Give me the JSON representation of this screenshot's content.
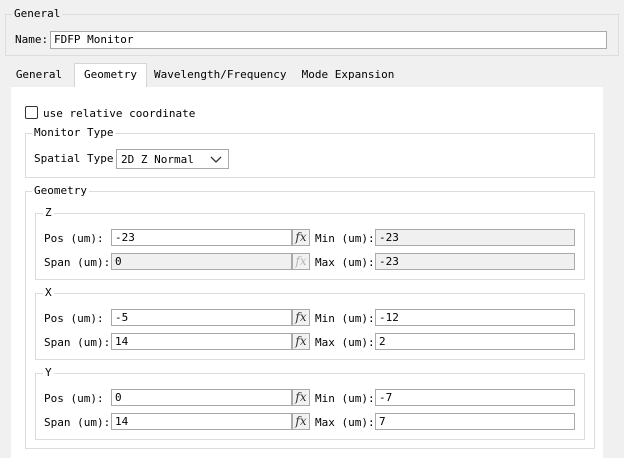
{
  "general_group": {
    "title": "General",
    "name_label": "Name:",
    "name_value": "FDFP Monitor"
  },
  "tabs": [
    {
      "label": "General"
    },
    {
      "label": "Geometry"
    },
    {
      "label": "Wavelength/Frequency"
    },
    {
      "label": "Mode Expansion"
    }
  ],
  "relative_coord": {
    "label": "use relative coordinate",
    "checked": false
  },
  "monitor_type": {
    "title": "Monitor Type",
    "spatial_label": "Spatial Type:",
    "spatial_value": "2D Z Normal"
  },
  "geometry": {
    "title": "Geometry",
    "fx_label": "fx",
    "z": {
      "title": "Z",
      "pos_label": "Pos (um):",
      "pos_value": "-23",
      "span_label": "Span (um):",
      "span_value": "0",
      "min_label": "Min (um):",
      "min_value": "-23",
      "max_label": "Max (um):",
      "max_value": "-23"
    },
    "x": {
      "title": "X",
      "pos_label": "Pos (um):",
      "pos_value": "-5",
      "span_label": "Span (um):",
      "span_value": "14",
      "min_label": "Min (um):",
      "min_value": "-12",
      "max_label": "Max (um):",
      "max_value": "2"
    },
    "y": {
      "title": "Y",
      "pos_label": "Pos (um):",
      "pos_value": "0",
      "span_label": "Span (um):",
      "span_value": "14",
      "min_label": "Min (um):",
      "min_value": "-7",
      "max_label": "Max (um):",
      "max_value": "7"
    }
  }
}
